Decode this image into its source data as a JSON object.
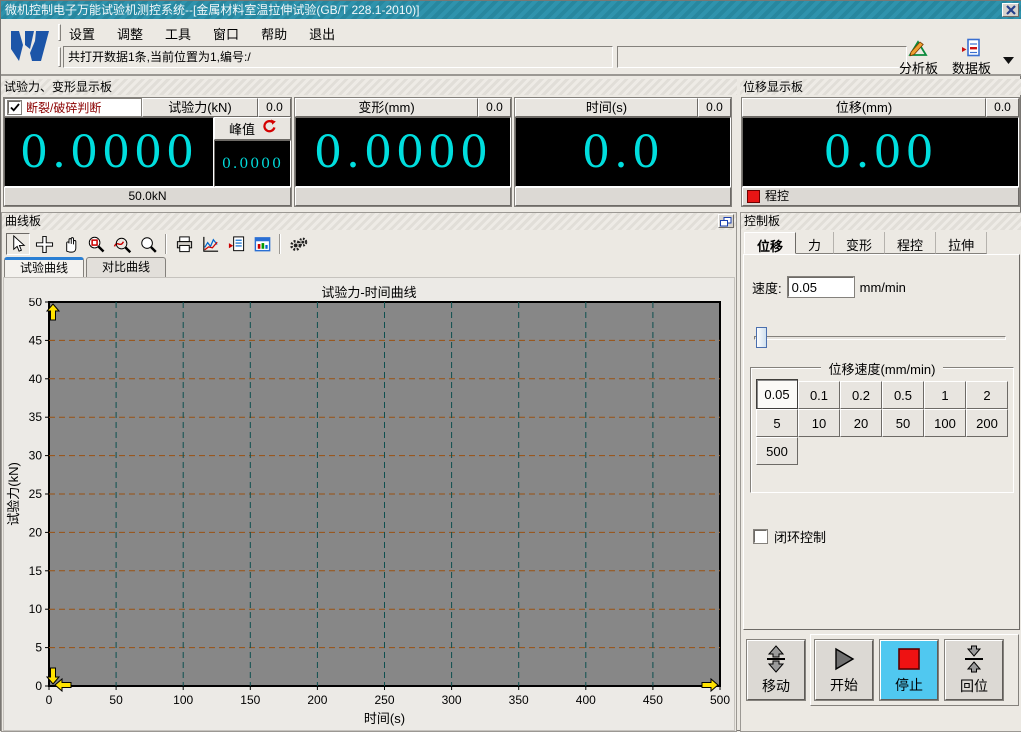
{
  "window": {
    "title": "微机控制电子万能试验机测控系统--[金属材料室温拉伸试验(GB/T 228.1-2010)]"
  },
  "menu": {
    "items": [
      "设置",
      "调整",
      "工具",
      "窗口",
      "帮助",
      "退出"
    ]
  },
  "statusbar": {
    "message": "共打开数据1条,当前位置为1,编号:/"
  },
  "quick_actions": {
    "analysis_label": "分析板",
    "data_label": "数据板"
  },
  "force_section": {
    "title": "试验力、变形显示板",
    "force_panel": {
      "break_check_label": "断裂/破碎判断",
      "break_checked": true,
      "header": "试验力(kN)",
      "rate": "0.0",
      "value": "0.0000",
      "peak_label": "峰值",
      "peak_value": "0.0000",
      "range": "50.0kN"
    },
    "deform_panel": {
      "header": "变形(mm)",
      "rate": "0.0",
      "value": "0.0000"
    },
    "time_panel": {
      "header": "时间(s)",
      "rate": "0.0",
      "value": "0.0"
    }
  },
  "displacement_section": {
    "title": "位移显示板",
    "panel": {
      "header": "位移(mm)",
      "rate": "0.0",
      "value": "0.00",
      "mode_label": "程控"
    }
  },
  "curve_panel": {
    "title": "曲线板",
    "toolbar": [
      "cursor",
      "move",
      "hand",
      "zoom-box",
      "zoom-curve",
      "zoom-out",
      "print",
      "curve-chart",
      "report",
      "data-window",
      "gears"
    ],
    "separators_after": [
      5,
      9
    ],
    "tabs": [
      {
        "label": "试验曲线",
        "active": true
      },
      {
        "label": "对比曲线",
        "active": false
      }
    ]
  },
  "chart_data": {
    "type": "line",
    "title": "试验力-时间曲线",
    "xlabel": "时间(s)",
    "ylabel": "试验力(kN)",
    "xlim": [
      0,
      500
    ],
    "xstep": 50,
    "ylim": [
      0,
      50
    ],
    "ystep": 5,
    "grid": true,
    "legend": "none",
    "series": [],
    "plot_bg": "#878787",
    "hgrid_color": "#9a5212",
    "vgrid_color": "#0e4f4f",
    "marker_color": "#ffe200"
  },
  "control_panel": {
    "title": "控制板",
    "tabs": [
      {
        "label": "位移",
        "active": true
      },
      {
        "label": "力",
        "active": false
      },
      {
        "label": "变形",
        "active": false
      },
      {
        "label": "程控",
        "active": false
      },
      {
        "label": "拉伸",
        "active": false
      }
    ],
    "speed_label": "速度:",
    "speed_value": "0.05",
    "speed_unit": "mm/min",
    "speed_group": {
      "title": "位移速度(mm/min)",
      "options": [
        "0.05",
        "0.1",
        "0.2",
        "0.5",
        "1",
        "2",
        "5",
        "10",
        "20",
        "50",
        "100",
        "200",
        "500"
      ],
      "selected": "0.05"
    },
    "closed_loop_label": "闭环控制",
    "closed_loop_checked": false,
    "buttons": {
      "move": "移动",
      "start": "开始",
      "stop": "停止",
      "home": "回位"
    }
  },
  "colors": {
    "display_text": "#00dede",
    "alert_text": "#8b0000",
    "stop_active_bg": "#50c8f0",
    "titlebar": "#2b8ba5",
    "active_tab_accent": "#2a7fd4"
  }
}
